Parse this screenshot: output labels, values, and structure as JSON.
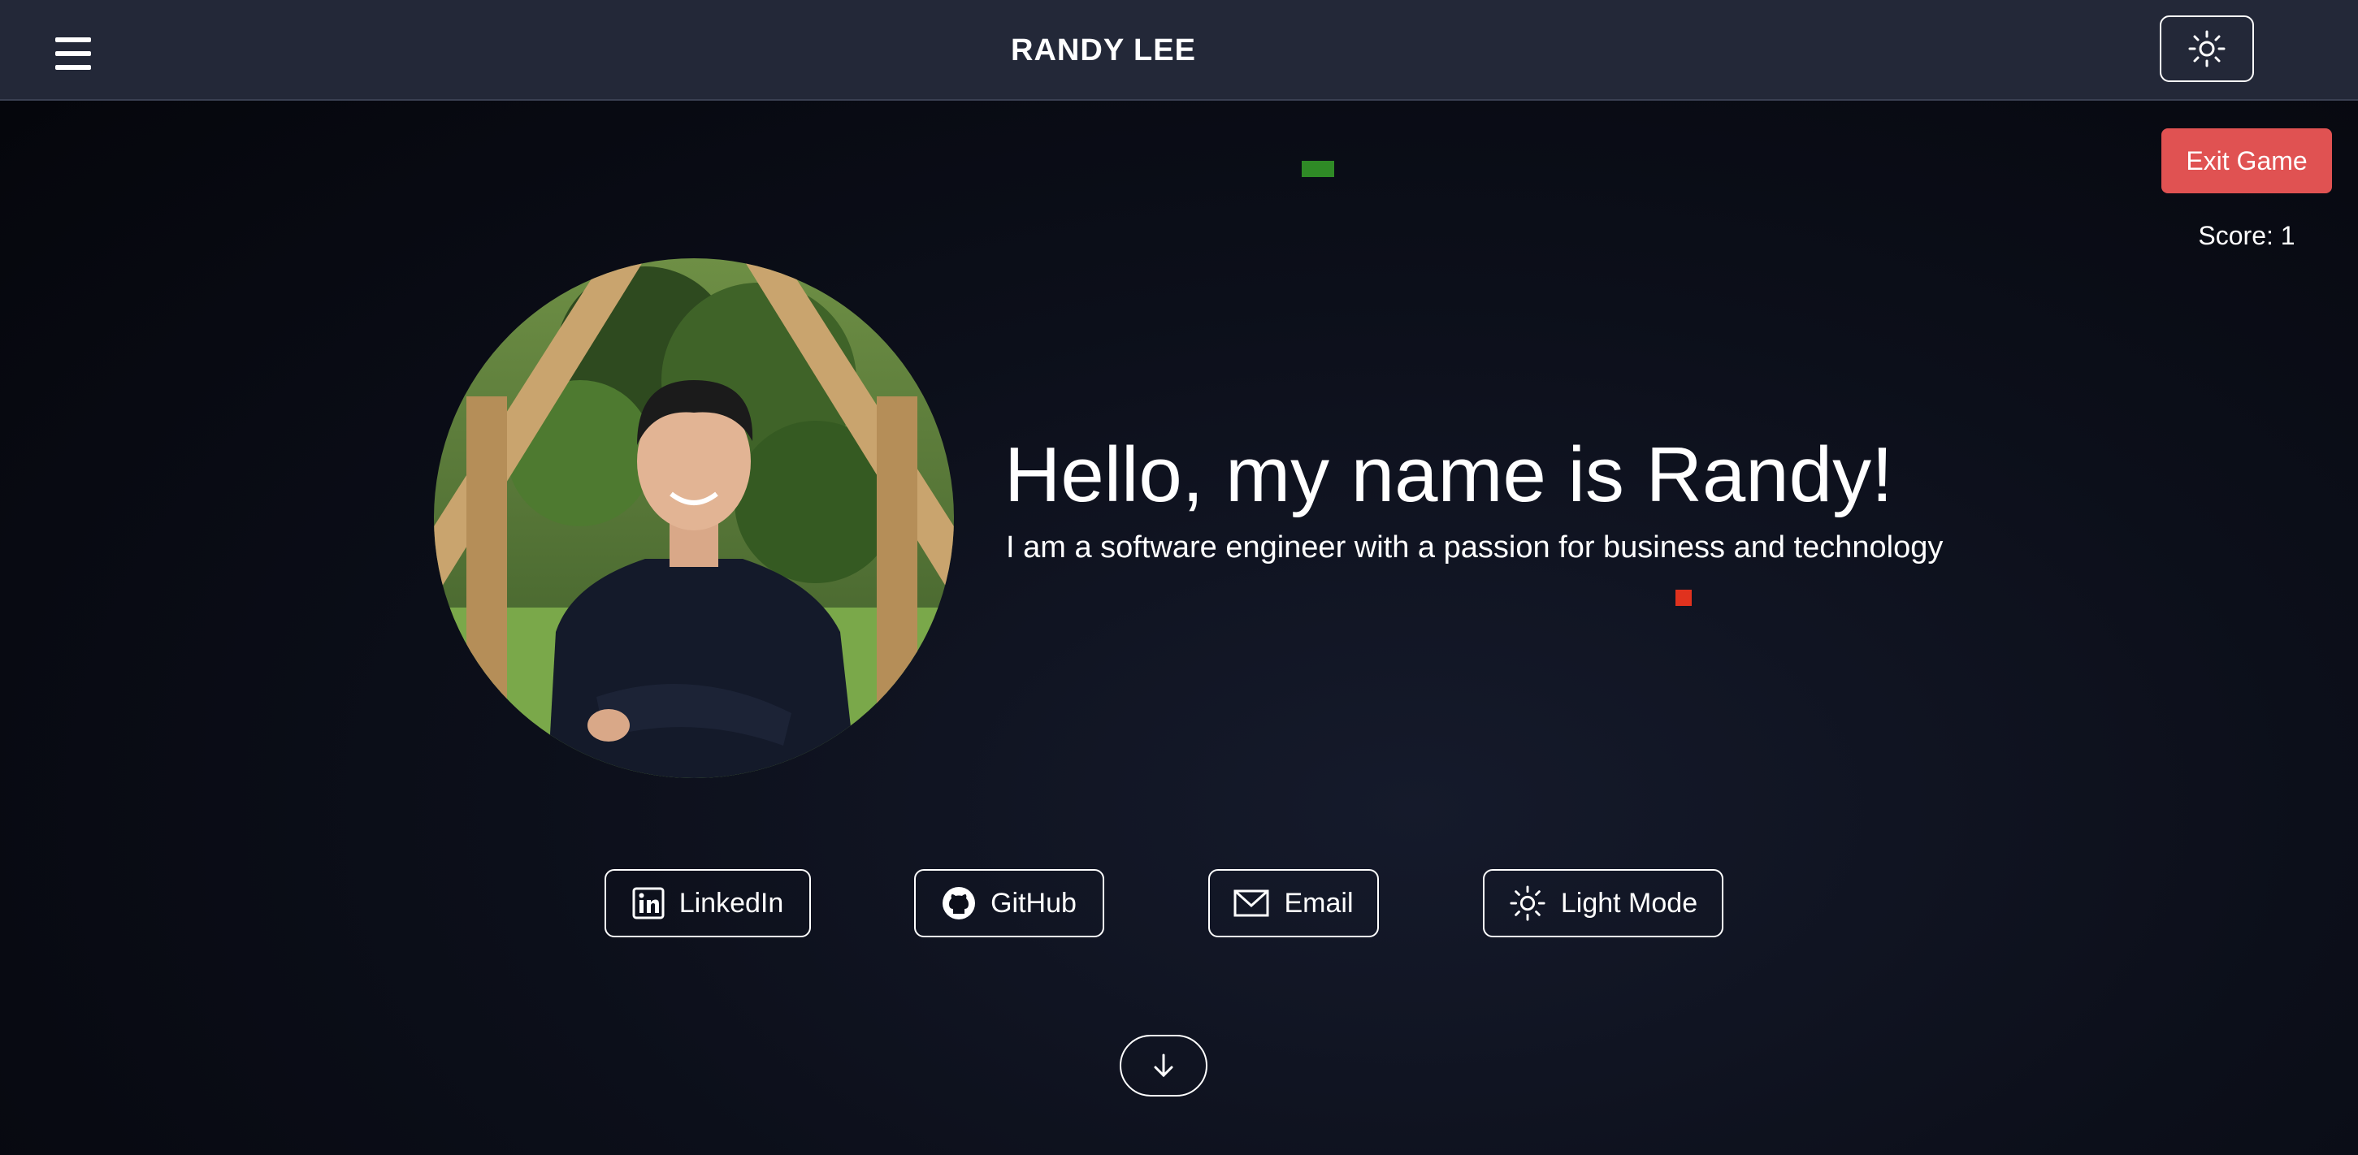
{
  "header": {
    "title": "RANDY LEE",
    "menu_icon": "hamburger-menu-icon",
    "theme_icon": "sun-icon"
  },
  "game": {
    "exit_label": "Exit Game",
    "score_text": "Score: 1",
    "snake_color": "#2f8a26",
    "food_color": "#e0321e"
  },
  "hero": {
    "heading": "Hello, my name is Randy!",
    "subheading": "I am a software engineer with a passion for business and technology",
    "photo": "profile-photo"
  },
  "social": {
    "linkedin_label": "LinkedIn",
    "github_label": "GitHub",
    "email_label": "Email",
    "light_mode_label": "Light Mode"
  },
  "scroll": {
    "icon": "arrow-down-icon"
  },
  "colors": {
    "header_bg": "#232838",
    "exit_button": "#e05252",
    "page_bg": "#0c0f1a"
  }
}
